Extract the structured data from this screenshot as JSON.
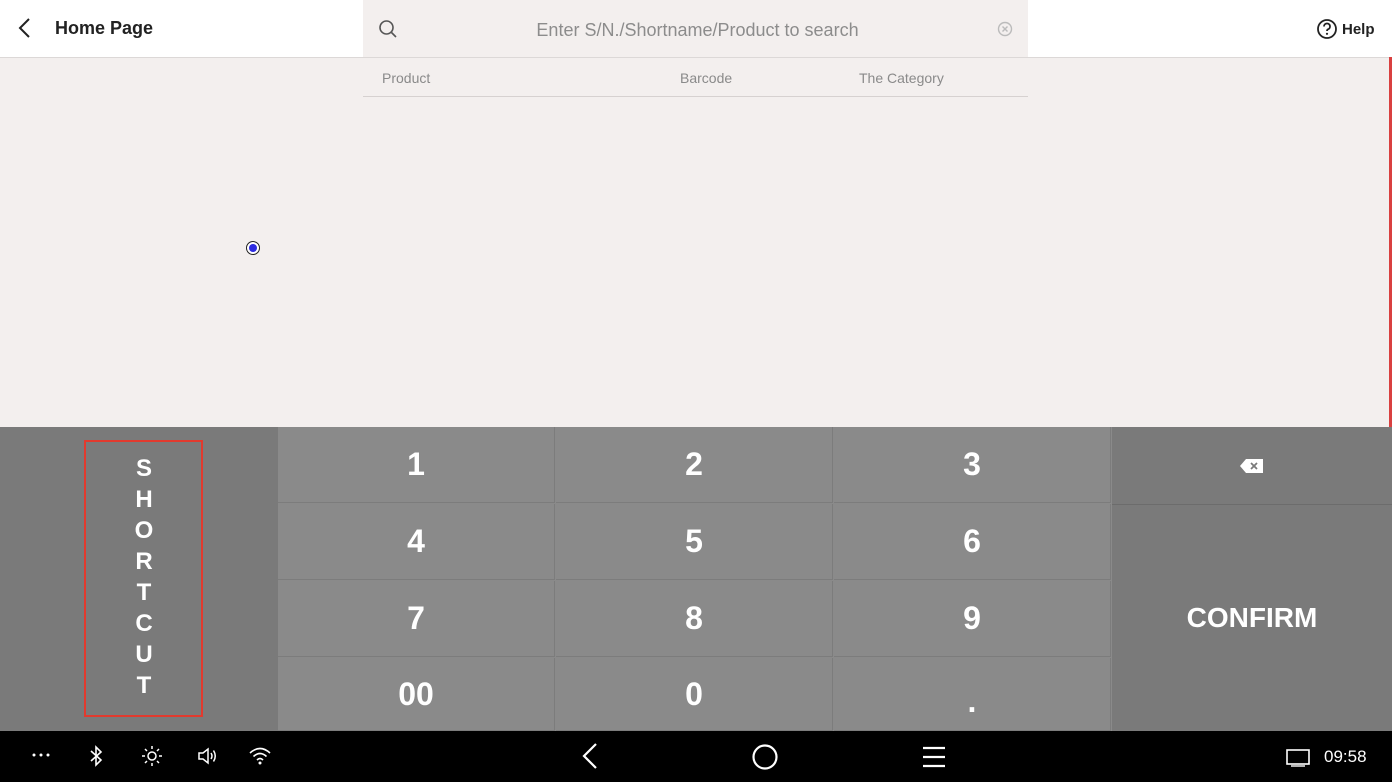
{
  "header": {
    "title": "Home Page",
    "search_placeholder": "Enter S/N./Shortname/Product to search",
    "help_label": "Help"
  },
  "table": {
    "columns": [
      "Product",
      "Barcode",
      "The Category"
    ]
  },
  "keypad": {
    "shortcut_label": "SHORTCUT",
    "keys": [
      "1",
      "2",
      "3",
      "4",
      "5",
      "6",
      "7",
      "8",
      "9",
      "00",
      "0",
      "."
    ],
    "confirm_label": "CONFIRM"
  },
  "system_bar": {
    "time": "09:58",
    "icons": [
      "more-icon",
      "bluetooth-icon",
      "brightness-icon",
      "volume-icon",
      "wifi-icon",
      "nav-back-icon",
      "nav-home-icon",
      "nav-menu-icon",
      "screen-icon"
    ]
  },
  "colors": {
    "highlight": "#e23a2e",
    "keypad_bg": "#8a8a8a",
    "content_bg": "#f3efee"
  }
}
